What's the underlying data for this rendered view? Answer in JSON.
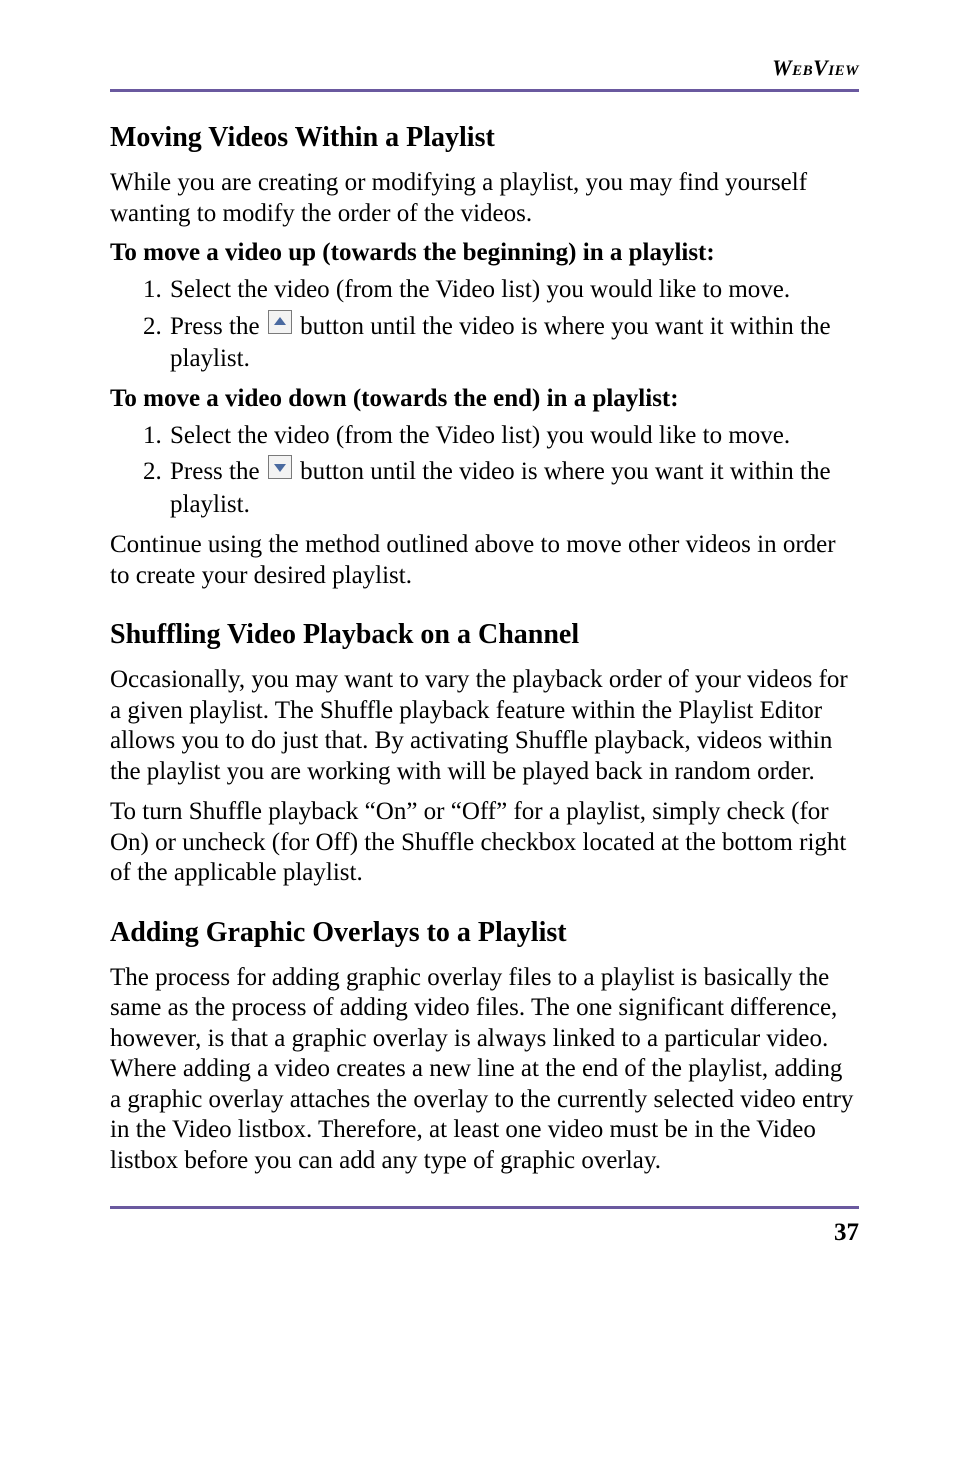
{
  "header": {
    "running_head": "WebView"
  },
  "sec1": {
    "title": "Moving Videos Within a Playlist",
    "intro": "While you are creating or modifying a playlist, you may find yourself wanting to modify the order of the videos.",
    "sub_up_title": "To move a video up (towards the beginning) in a playlist:",
    "up_step1": "Select the video (from the Video list) you would like to move.",
    "up_step2a": "Press the ",
    "up_step2b": " button until the video is where you want it within the playlist.",
    "sub_down_title": "To move a video down (towards the end) in a playlist:",
    "down_step1": "Select the video (from the Video list) you would like to move.",
    "down_step2a": "Press the ",
    "down_step2b": " button until the video is where you want it within the playlist.",
    "outro": "Continue using the method outlined above to move other videos in order to create your desired playlist."
  },
  "sec2": {
    "title": "Shuffling Video Playback on a Channel",
    "p1": "Occasionally, you may want to vary the playback order of your videos for a given playlist. The Shuffle playback feature within the Playlist Editor allows you to do just that. By activating Shuffle playback, videos within the playlist you are working with will be played back in random order.",
    "p2": "To turn Shuffle playback “On” or “Off” for a playlist, simply check (for On) or uncheck (for Off) the Shuffle checkbox located at the bottom right of the applicable playlist."
  },
  "sec3": {
    "title": "Adding Graphic Overlays to a Playlist",
    "p1": "The process for adding graphic overlay files to a playlist is basically the same as the process of adding video files. The one significant difference, however, is that a graphic overlay is always linked to a particular video. Where adding a video creates a new line at the end of the playlist, adding a graphic overlay attaches the overlay to the currently selected video entry in the Video listbox. Therefore, at least one video must be in the Video listbox before you can add any type of graphic overlay."
  },
  "footer": {
    "page_number": "37"
  }
}
